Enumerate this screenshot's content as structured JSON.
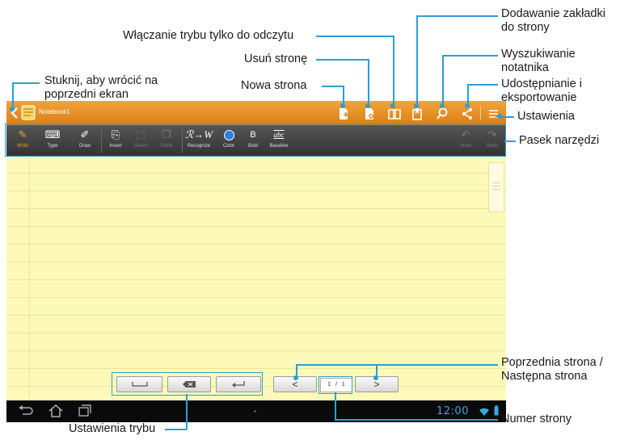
{
  "callouts": {
    "back": [
      "Stuknij, aby wrócić na",
      "poprzedni ekran"
    ],
    "readonly": "Włączanie trybu tylko do odczytu",
    "delete_page": "Usuń stronę",
    "new_page": "Nowa strona",
    "bookmark": [
      "Dodawanie zakładki",
      "do strony"
    ],
    "search": [
      "Wyszukiwanie",
      "notatnika"
    ],
    "share": [
      "Udostępnianie i",
      "eksportowanie"
    ],
    "settings": "Ustawienia",
    "toolbar": "Pasek narzędzi",
    "prev_next": [
      "Poprzednia strona /",
      "Następna strona"
    ],
    "page_number": "Numer strony",
    "mode_settings": "Ustawienia trybu"
  },
  "app": {
    "notebook_title": "Notebook1",
    "toolbar": {
      "write": "Write",
      "type": "Type",
      "draw": "Draw",
      "insert": "Insert",
      "select": "Select",
      "paste": "Paste",
      "recognize": "Recognize",
      "recognize_glyph": "ℛ→W",
      "color": "Color",
      "bold": "Bold",
      "bold_glyph": "B",
      "baseline": "Baseline",
      "baseline_glyph": "abc",
      "undo": "Undo",
      "redo": "Redo"
    },
    "page_indicator": {
      "current": "1",
      "separator": "/",
      "total": "1"
    },
    "nav_buttons": {
      "prev": "<",
      "next": ">"
    },
    "clock": "12:00"
  },
  "colors": {
    "accent": "#f0a030",
    "callout_line": "#2a9fd8",
    "paper": "#fdf9b8"
  }
}
